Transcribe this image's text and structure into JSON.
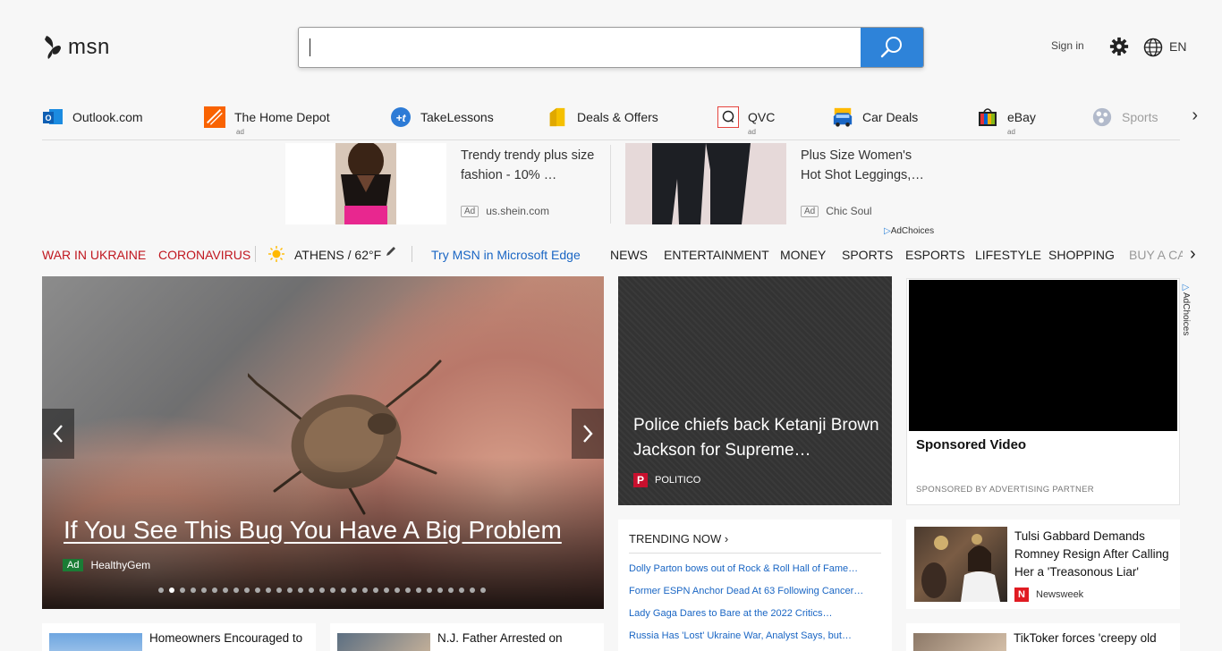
{
  "header": {
    "logo_text": "msn",
    "search_placeholder": "",
    "signin": "Sign in",
    "lang": "EN"
  },
  "shortcuts": [
    {
      "label": "Outlook.com",
      "ad": "",
      "icon": "outlook-icon"
    },
    {
      "label": "The Home Depot",
      "ad": "ad",
      "icon": "home-depot-icon"
    },
    {
      "label": "TakeLessons",
      "ad": "",
      "icon": "takelessons-icon"
    },
    {
      "label": "Deals & Offers",
      "ad": "",
      "icon": "deals-icon"
    },
    {
      "label": "QVC",
      "ad": "ad",
      "icon": "qvc-icon"
    },
    {
      "label": "Car Deals",
      "ad": "",
      "icon": "car-icon"
    },
    {
      "label": "eBay",
      "ad": "ad",
      "icon": "ebay-icon"
    },
    {
      "label": "Sports",
      "ad": "",
      "icon": "sports-icon"
    }
  ],
  "ads": [
    {
      "title": "Trendy trendy plus size fashion - 10% …",
      "badge": "Ad",
      "source": "us.shein.com"
    },
    {
      "title": "Plus Size Women's Hot Shot Leggings,…",
      "badge": "Ad",
      "source": "Chic Soul"
    }
  ],
  "adchoices": "AdChoices",
  "nav": {
    "hot1": "WAR IN UKRAINE",
    "hot2": "CORONAVIRUS",
    "weather": "ATHENS / 62°F",
    "edge": "Try MSN in Microsoft Edge",
    "items": [
      "NEWS",
      "ENTERTAINMENT",
      "MONEY",
      "SPORTS",
      "ESPORTS",
      "LIFESTYLE",
      "SHOPPING",
      "BUY A CA"
    ]
  },
  "hero": {
    "title": "If You See This Bug You Have A Big Problem",
    "badge": "Ad",
    "source": "HealthyGem",
    "dot_count": 31,
    "active_dot": 1
  },
  "politico": {
    "title": "Police chiefs back Ketanji Brown Jackson for Supreme…",
    "logo": "P",
    "source": "POLITICO"
  },
  "video": {
    "title": "Sponsored Video",
    "partner": "SPONSORED BY ADVERTISING PARTNER",
    "adchoices": "AdChoices"
  },
  "trending": {
    "heading": "TRENDING NOW ›",
    "items": [
      "Dolly Parton bows out of Rock & Roll Hall of Fame…",
      "Former ESPN Anchor Dead At 63 Following Cancer…",
      "Lady Gaga Dares to Bare at the 2022 Critics…",
      "Russia Has 'Lost' Ukraine War, Analyst Says, but…"
    ]
  },
  "tulsi": {
    "title": "Tulsi Gabbard Demands Romney Resign After Calling Her a 'Treasonous Liar'",
    "logo": "N",
    "source": "Newsweek"
  },
  "bottom": [
    {
      "title": "Homeowners Encouraged to"
    },
    {
      "title": "N.J. Father Arrested on"
    },
    {
      "title": "TikToker forces 'creepy old"
    }
  ],
  "colors": {
    "accent": "#2e83d9",
    "hot": "#c0171f",
    "link": "#1a66c4"
  }
}
